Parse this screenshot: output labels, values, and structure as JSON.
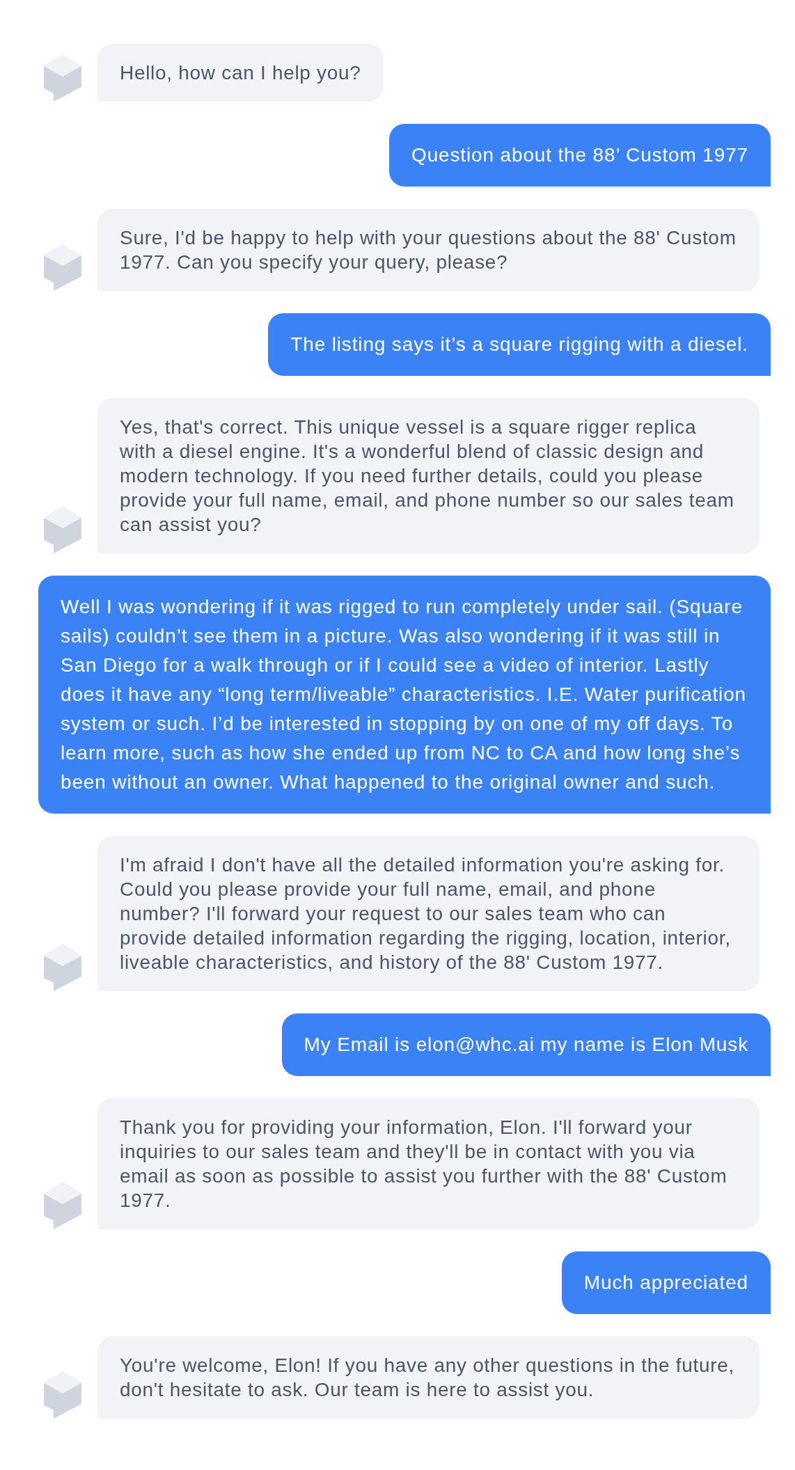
{
  "messages": [
    {
      "kind": "bot",
      "text": "Hello, how can I help you?"
    },
    {
      "kind": "user",
      "text": "Question about the 88’ Custom 1977"
    },
    {
      "kind": "bot",
      "text": "Sure, I'd be happy to help with your questions about the 88' Custom 1977. Can you specify your query, please?"
    },
    {
      "kind": "user",
      "text": "The listing says it’s a square rigging with a diesel."
    },
    {
      "kind": "bot",
      "text": "Yes, that's correct. This unique vessel is a square rigger replica with a diesel engine. It's a wonderful blend of classic design and modern technology. If you need further details, could you please provide your full name, email, and phone number so our sales team can assist you?"
    },
    {
      "kind": "user",
      "text": "Well I was wondering if it was rigged to run completely under sail. (Square sails) couldn’t see them in a picture. Was also wondering if it was still in San Diego for a walk through or if I could see a video of interior. Lastly does it have any “long term/liveable” characteristics. I.E. Water purification system or such. I’d be interested in stopping by on one of my off days. To learn more, such as how she ended up from NC to CA and how long she’s been without an owner. What happened to the original owner and such."
    },
    {
      "kind": "bot",
      "text": "I'm afraid I don't have all the detailed information you're asking for. Could you please provide your full name, email, and phone number? I'll forward your request to our sales team who can provide detailed information regarding the rigging, location, interior, liveable characteristics, and history of the 88' Custom 1977."
    },
    {
      "kind": "user",
      "text": "My Email is elon@whc.ai my name is Elon Musk"
    },
    {
      "kind": "bot",
      "text": "Thank you for providing your information, Elon. I'll forward your inquiries to our sales team and they'll be in contact with you via email as soon as possible to assist you further with the 88' Custom 1977."
    },
    {
      "kind": "user",
      "text": "Much appreciated"
    },
    {
      "kind": "bot",
      "text": "You're welcome, Elon! If you have any other questions in the future, don't hesitate to ask. Our team is here to assist you."
    }
  ]
}
